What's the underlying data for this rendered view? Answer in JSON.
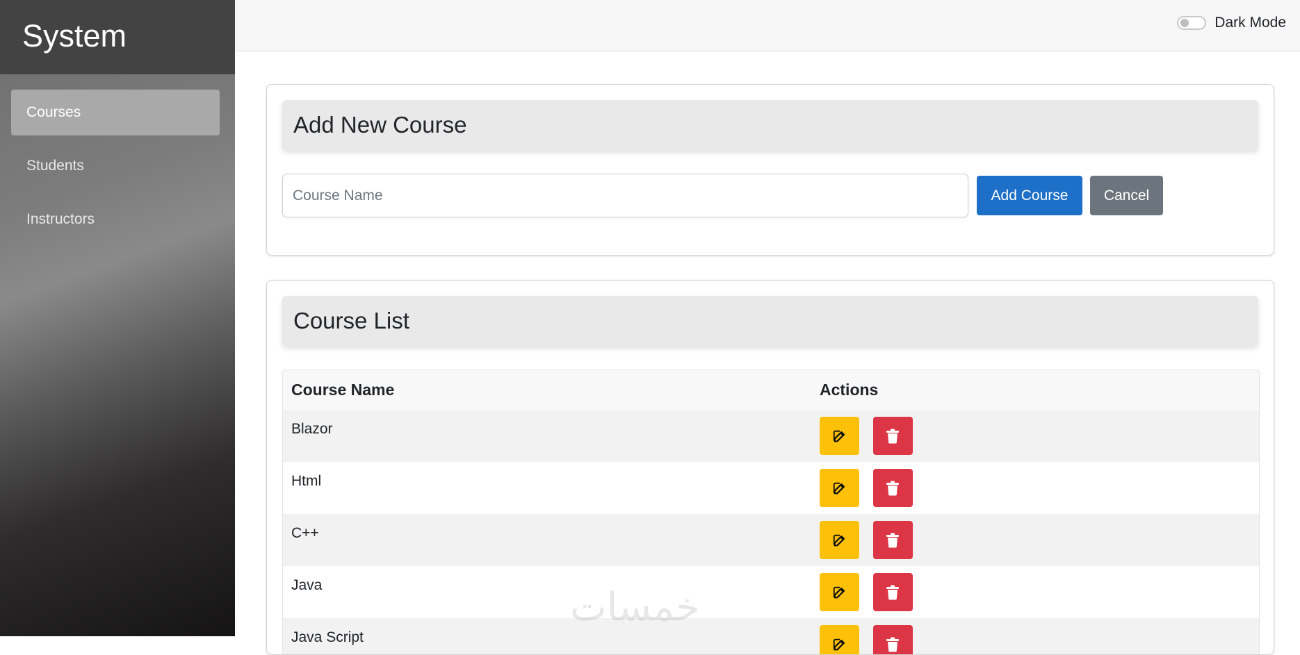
{
  "sidebar": {
    "brand": "System",
    "items": [
      {
        "label": "Courses",
        "active": true
      },
      {
        "label": "Students",
        "active": false
      },
      {
        "label": "Instructors",
        "active": false
      }
    ]
  },
  "topbar": {
    "dark_mode_label": "Dark Mode",
    "dark_mode_on": false
  },
  "add_card": {
    "title": "Add New Course",
    "input_placeholder": "Course Name",
    "input_value": "",
    "add_label": "Add Course",
    "cancel_label": "Cancel"
  },
  "list_card": {
    "title": "Course List",
    "columns": [
      "Course Name",
      "Actions"
    ],
    "rows": [
      {
        "name": "Blazor"
      },
      {
        "name": "Html"
      },
      {
        "name": "C++"
      },
      {
        "name": "Java"
      },
      {
        "name": "Java Script"
      }
    ]
  },
  "icons": {
    "edit": "edit-icon",
    "delete": "trash-icon"
  },
  "colors": {
    "primary": "#1d6fc7",
    "secondary": "#6c757d",
    "warning": "#ffc107",
    "danger": "#dc3545"
  },
  "watermark": "خمسات"
}
